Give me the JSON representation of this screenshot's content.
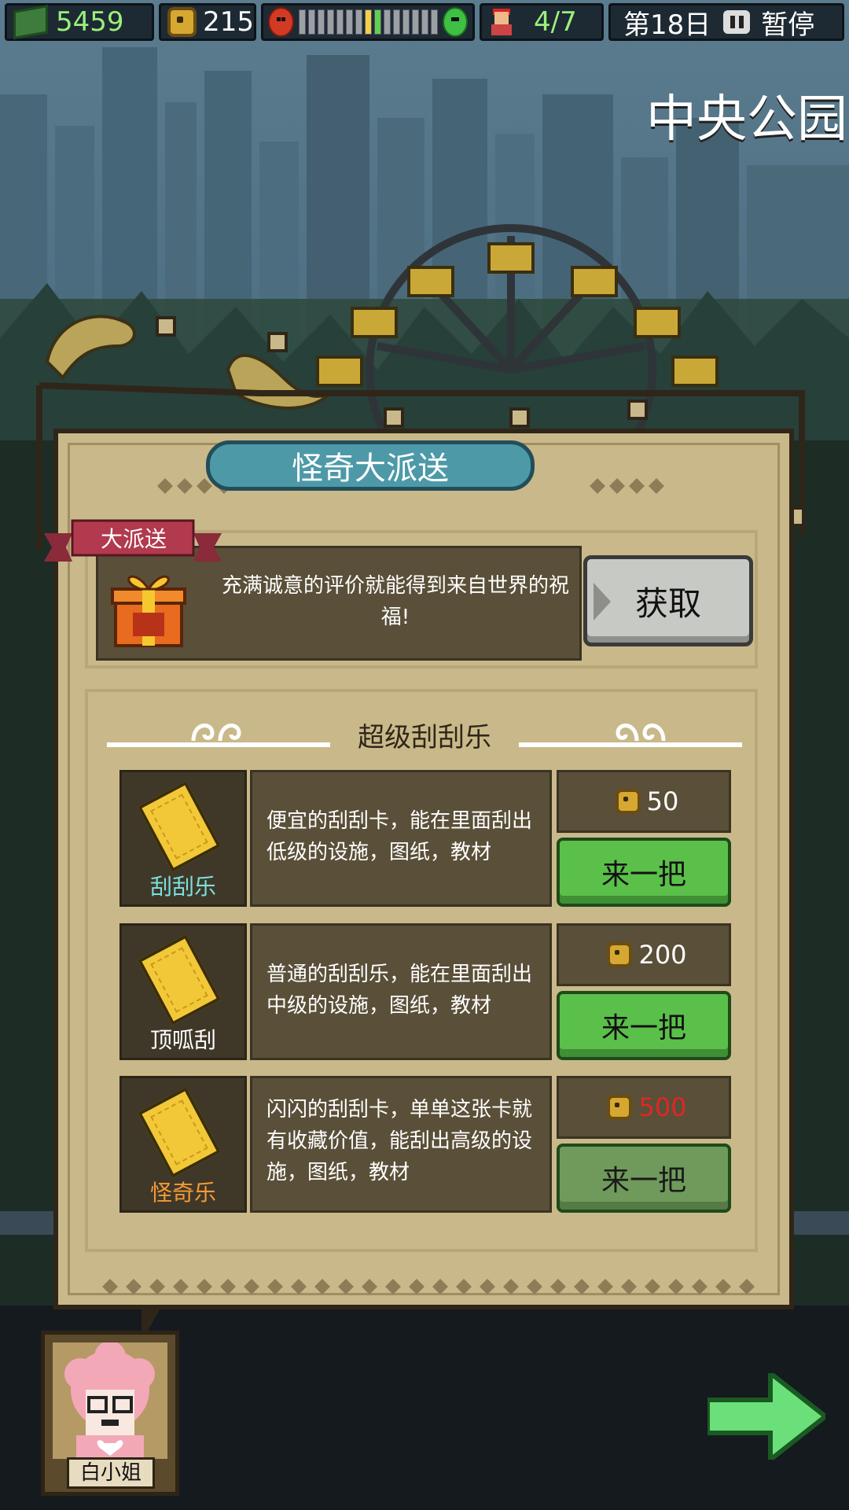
{
  "hud": {
    "cash": "5459",
    "coins": "215",
    "mood_level": 0.6,
    "staff": "4/7",
    "day": "第18日",
    "pause_label": "暂停"
  },
  "location": "中央公园",
  "panel": {
    "title": "怪奇大派送",
    "promo": {
      "ribbon": "大派送",
      "text": "充满诚意的评价就能得到来自世界的祝福!",
      "button": "获取"
    },
    "section_title": "超级刮刮乐",
    "items": [
      {
        "name": "刮刮乐",
        "description": "便宜的刮刮卡，能在里面刮出低级的设施，图纸，教材",
        "price": "50",
        "button": "来一把",
        "affordable": true
      },
      {
        "name": "顶呱刮",
        "description": "普通的刮刮乐，能在里面刮出中级的设施，图纸，教材",
        "price": "200",
        "button": "来一把",
        "affordable": true
      },
      {
        "name": "怪奇乐",
        "description": "闪闪的刮刮卡，单单这张卡就有收藏价值，能刮出高级的设施，图纸，教材",
        "price": "500",
        "button": "来一把",
        "affordable": false
      }
    ]
  },
  "npc": {
    "name": "白小姐"
  },
  "colors": {
    "panel": "#c9b98a",
    "title_bar": "#4d99a8",
    "button_green": "#5ac04a",
    "price_unaffordable": "#e02626"
  },
  "icons": [
    "cash-icon",
    "coin-icon",
    "angry-face-icon",
    "happy-face-icon",
    "staff-icon",
    "pause-icon",
    "gift-icon",
    "scratch-card-icon",
    "next-arrow-icon"
  ]
}
